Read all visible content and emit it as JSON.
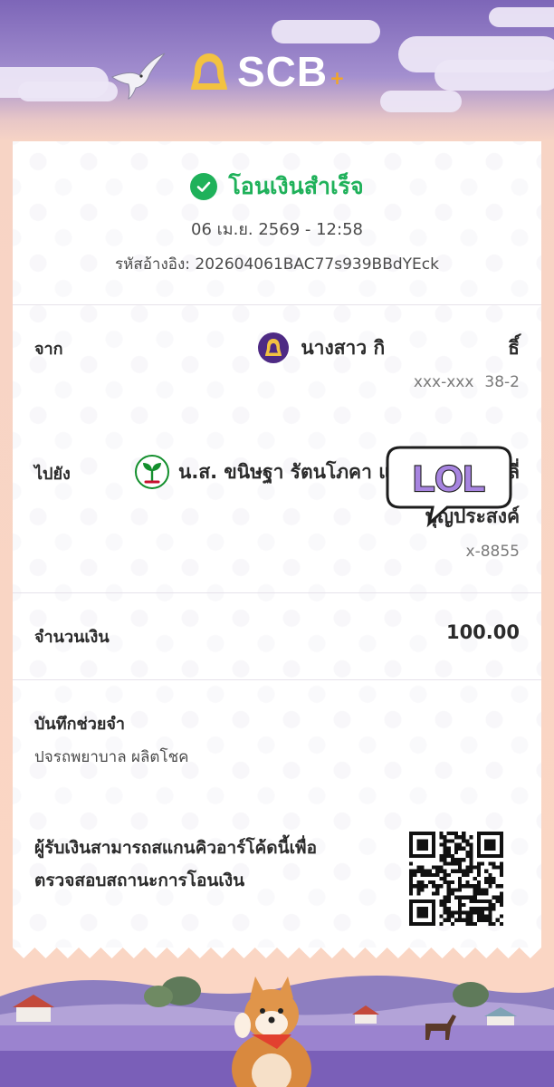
{
  "header": {
    "brand": "SCB",
    "brand_suffix": "+"
  },
  "receipt": {
    "status": "โอนเงินสำเร็จ",
    "datetime": "06 เม.ย. 2569 - 12:58",
    "reference": "รหัสอ้างอิง: 202604061BAC77s939BBdYEck",
    "from": {
      "label": "จาก",
      "name": "นางสาว กิ",
      "name_tail": "ธิ์",
      "account": "xxx-xxx",
      "account_tail": "38-2"
    },
    "to": {
      "label": "ไปยัง",
      "name_line1": "น.ส. ขนิษฐา รัตนโภคา และ น.ส. เอ็มมิลี่",
      "name_line2": "บุญประสงค์",
      "account": "x-8855"
    },
    "amount": {
      "label": "จำนวนเงิน",
      "value": "100.00"
    },
    "memo": {
      "label": "บันทึกช่วยจำ",
      "value": "ปจรถพยาบาล ผลิตโชค"
    },
    "qr_note_line1": "ผู้รับเงินสามารถสแกนคิวอาร์โค้ดนี้เพื่อ",
    "qr_note_line2": "ตรวจสอบสถานะการโอนเงิน"
  },
  "sticker": {
    "text": "LOL"
  },
  "icons": {
    "success": "check-circle-icon",
    "scb_bank": "scb-bank-icon",
    "kbank_bank": "kbank-bank-icon",
    "qr": "qr-code-icon"
  },
  "colors": {
    "success_green": "#1fb15a",
    "scb_purple": "#4e2a84",
    "kbank_green": "#138f2d",
    "background_peach": "#fbd6c4",
    "sky_purple": "#7d66b8"
  }
}
